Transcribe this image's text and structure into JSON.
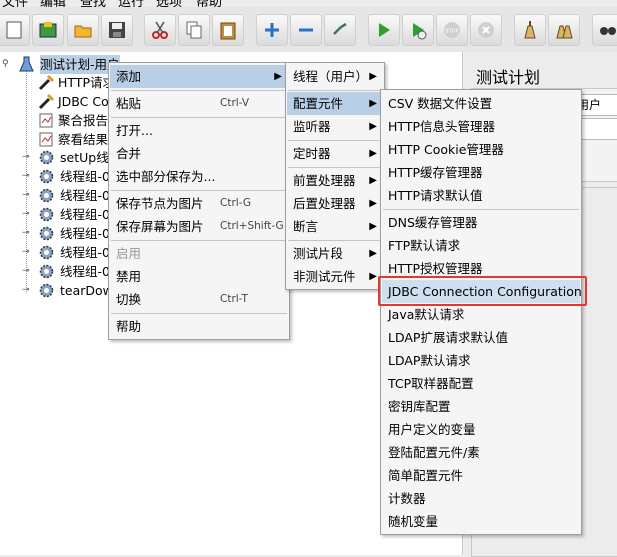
{
  "menubar": [
    "文件",
    "编辑",
    "查找",
    "运行",
    "选项",
    "帮助"
  ],
  "toolbar": {
    "buttons": [
      "new-icon",
      "templates-icon",
      "open-icon",
      "save-icon",
      "cut-icon",
      "copy-icon",
      "paste-icon",
      "expand-icon",
      "collapse-icon",
      "toggle-icon",
      "start-icon",
      "start-no-pause-icon",
      "stop-icon",
      "shutdown-icon",
      "clear-icon",
      "clear-all-icon",
      "search-icon"
    ]
  },
  "tree": {
    "root": "测试计划-用户",
    "children": [
      {
        "label": "HTTP请求",
        "icon": "wrench-icon"
      },
      {
        "label": "JDBC Co",
        "icon": "wrench-icon"
      },
      {
        "label": "聚合报告",
        "icon": "report-icon"
      },
      {
        "label": "察看结果",
        "icon": "report-icon"
      },
      {
        "label": "setUp线程",
        "icon": "gear-icon"
      },
      {
        "label": "线程组-0",
        "icon": "gear-icon"
      },
      {
        "label": "线程组-0",
        "icon": "gear-icon"
      },
      {
        "label": "线程组-0",
        "icon": "gear-icon"
      },
      {
        "label": "线程组-0",
        "icon": "gear-icon"
      },
      {
        "label": "线程组-0",
        "icon": "gear-icon"
      },
      {
        "label": "线程组-0",
        "icon": "gear-icon"
      },
      {
        "label": "tearDown",
        "icon": "gear-icon"
      }
    ]
  },
  "right_panel": {
    "title": "测试计划",
    "name_value": "用户",
    "comment_value": ""
  },
  "context_menu": [
    {
      "label": "添加",
      "has_submenu": true,
      "active": true
    },
    {
      "label": "粘贴",
      "shortcut": "Ctrl-V"
    },
    {
      "label": "打开..."
    },
    {
      "label": "合并"
    },
    {
      "label": "选中部分保存为..."
    },
    {
      "label": "保存节点为图片",
      "shortcut": "Ctrl-G"
    },
    {
      "label": "保存屏幕为图片",
      "shortcut": "Ctrl+Shift-G"
    },
    {
      "label": "启用",
      "disabled": true
    },
    {
      "label": "禁用"
    },
    {
      "label": "切换",
      "shortcut": "Ctrl-T"
    },
    {
      "label": "帮助"
    }
  ],
  "add_submenu": [
    {
      "label": "线程（用户）",
      "has_submenu": true
    },
    {
      "label": "配置元件",
      "has_submenu": true,
      "active": true
    },
    {
      "label": "监听器",
      "has_submenu": true
    },
    {
      "label": "定时器",
      "has_submenu": true
    },
    {
      "label": "前置处理器",
      "has_submenu": true
    },
    {
      "label": "后置处理器",
      "has_submenu": true
    },
    {
      "label": "断言",
      "has_submenu": true
    },
    {
      "label": "测试片段",
      "has_submenu": true
    },
    {
      "label": "非测试元件",
      "has_submenu": true
    }
  ],
  "config_submenu": [
    "CSV 数据文件设置",
    "HTTP信息头管理器",
    "HTTP Cookie管理器",
    "HTTP缓存管理器",
    "HTTP请求默认值",
    "DNS缓存管理器",
    "FTP默认请求",
    "HTTP授权管理器",
    "JDBC Connection Configuration",
    "Java默认请求",
    "LDAP扩展请求默认值",
    "LDAP默认请求",
    "TCP取样器配置",
    "密钥库配置",
    "用户定义的变量",
    "登陆配置元件/素",
    "简单配置元件",
    "计数器",
    "随机变量"
  ],
  "colors": {
    "highlight_border": "#e8372e",
    "active_item": "#b8cfe5"
  }
}
